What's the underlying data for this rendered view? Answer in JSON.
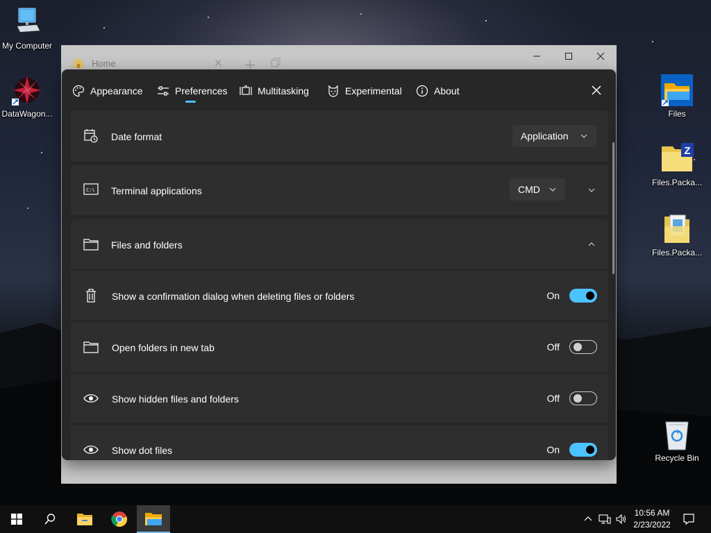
{
  "desktop": {
    "icons": [
      {
        "label": "My Computer"
      },
      {
        "label": "DataWagon..."
      },
      {
        "label": "Files"
      },
      {
        "label": "Files.Packa..."
      },
      {
        "label": "Files.Packa..."
      },
      {
        "label": "Recycle Bin"
      }
    ]
  },
  "files_window": {
    "tab_title": "Home"
  },
  "settings": {
    "nav": [
      {
        "label": "Appearance",
        "icon": "palette-icon"
      },
      {
        "label": "Preferences",
        "icon": "sliders-icon",
        "selected": true
      },
      {
        "label": "Multitasking",
        "icon": "multitasking-icon"
      },
      {
        "label": "Experimental",
        "icon": "cat-icon"
      },
      {
        "label": "About",
        "icon": "info-icon"
      }
    ],
    "date_format": {
      "label": "Date format",
      "value": "Application"
    },
    "terminal": {
      "label": "Terminal applications",
      "value": "CMD"
    },
    "files_folders": {
      "label": "Files and folders",
      "expanded": true
    },
    "options": [
      {
        "label": "Show a confirmation dialog when deleting files or folders",
        "state": "On",
        "icon": "trash-icon"
      },
      {
        "label": "Open folders in new tab",
        "state": "Off",
        "icon": "folder-icon"
      },
      {
        "label": "Show hidden files and folders",
        "state": "Off",
        "icon": "eye-icon"
      },
      {
        "label": "Show dot files",
        "state": "On",
        "icon": "eye-icon"
      }
    ],
    "accent_color": "#4cc2ff"
  },
  "taskbar": {
    "time": "10:56 AM",
    "date": "2/23/2022"
  }
}
